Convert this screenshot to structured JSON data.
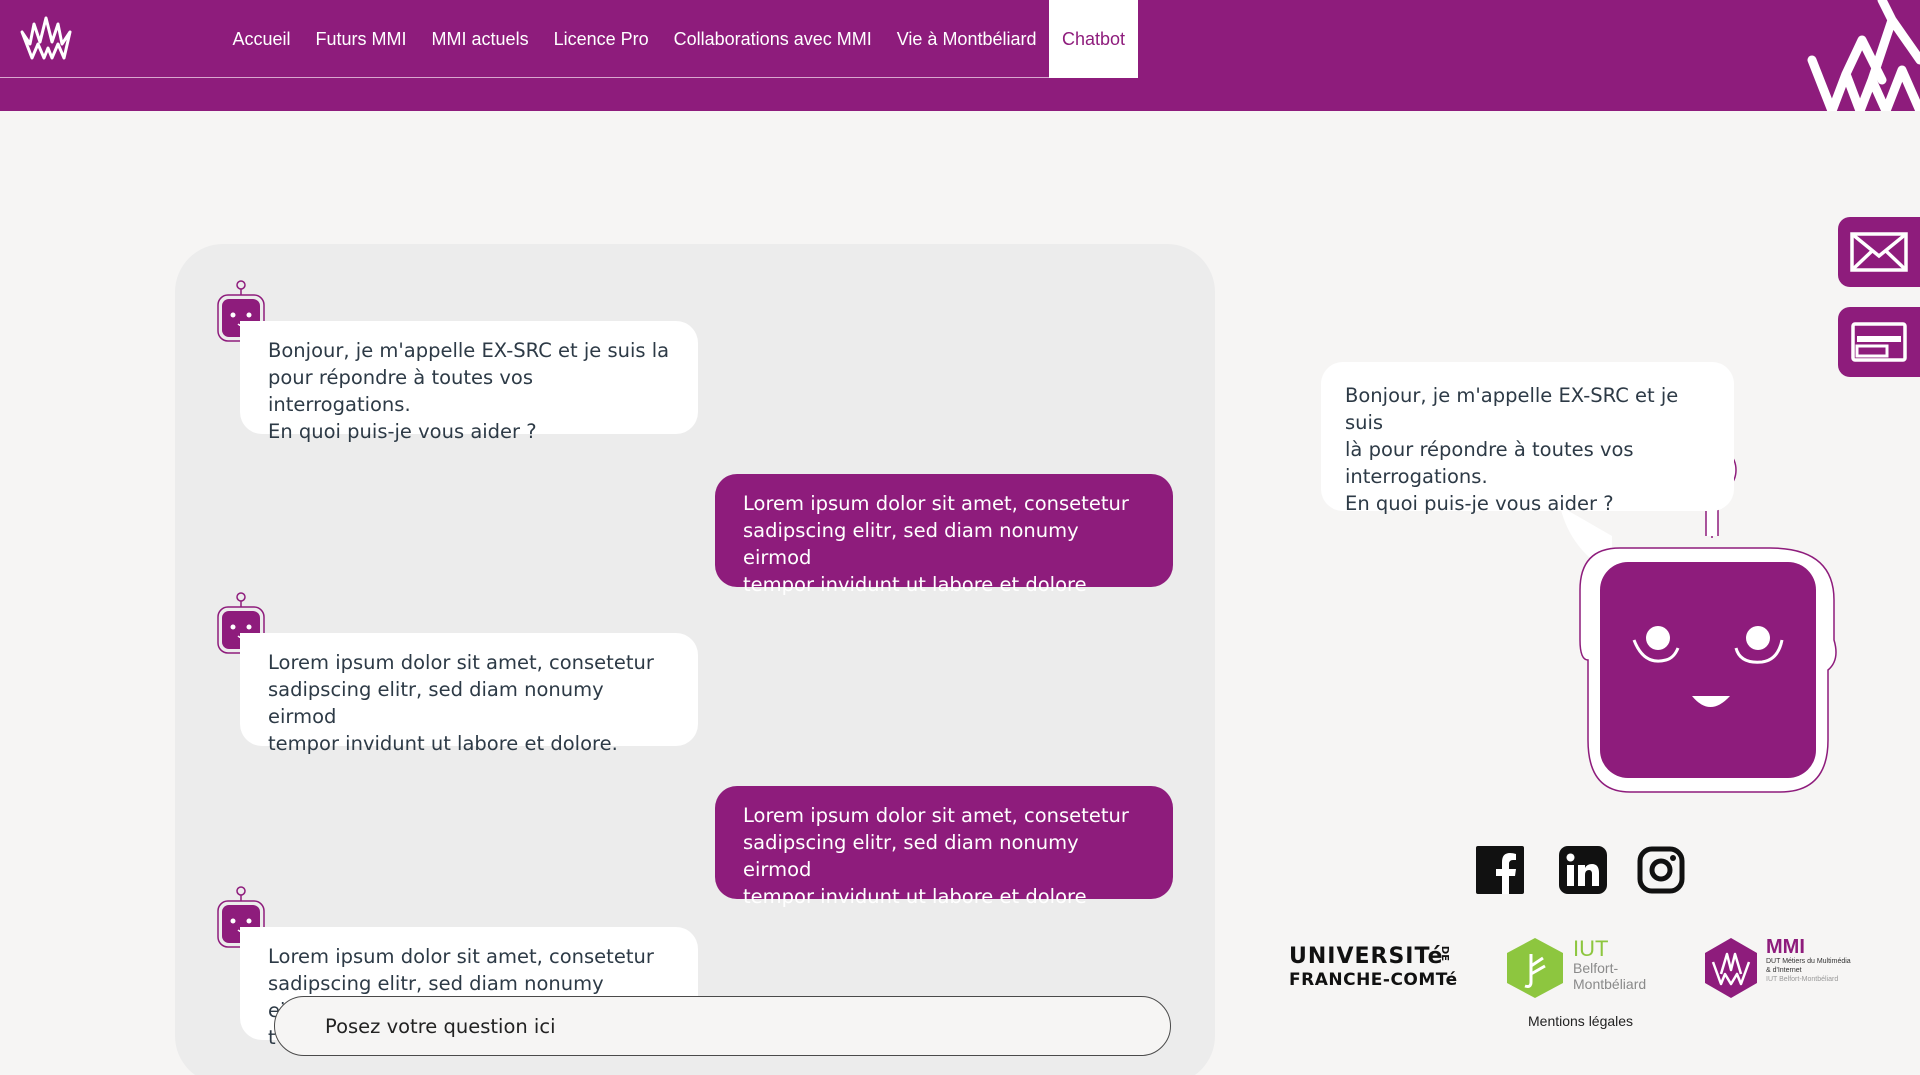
{
  "header": {
    "nav": [
      {
        "label": "Accueil"
      },
      {
        "label": "Futurs MMI"
      },
      {
        "label": "MMI actuels"
      },
      {
        "label": "Licence Pro"
      },
      {
        "label": "Collaborations avec MMI"
      },
      {
        "label": "Vie à Montbéliard"
      },
      {
        "label": "Chatbot",
        "active": true
      }
    ]
  },
  "side_tabs": {
    "mail_icon": "envelope-icon",
    "browser_icon": "window-icon"
  },
  "chat": {
    "messages": [
      {
        "from": "bot",
        "text": "Bonjour, je m'appelle EX-SRC et je suis la\npour répondre à toutes vos interrogations.\nEn quoi puis-je vous aider ?"
      },
      {
        "from": "user",
        "text": "Lorem ipsum dolor sit amet, consetetur\nsadipscing elitr, sed diam nonumy eirmod\ntempor invidunt ut labore et dolore"
      },
      {
        "from": "bot",
        "text": "Lorem ipsum dolor sit amet, consetetur\nsadipscing elitr, sed diam nonumy eirmod\ntempor invidunt ut labore et dolore."
      },
      {
        "from": "user",
        "text": "Lorem ipsum dolor sit amet, consetetur\nsadipscing elitr, sed diam nonumy eirmod\ntempor invidunt ut labore et dolore"
      },
      {
        "from": "bot",
        "text": "Lorem ipsum dolor sit amet, consetetur\nsadipscing elitr, sed diam nonumy eirmod\nt"
      }
    ],
    "input_placeholder": "Posez votre question ici"
  },
  "robot_panel": {
    "greeting": "Bonjour, je m'appelle EX-SRC et je suis\nlà pour répondre à toutes vos\ninterrogations.\nEn quoi puis-je vous aider ?"
  },
  "social": [
    "facebook-icon",
    "linkedin-icon",
    "instagram-icon"
  ],
  "partners": {
    "ufc_line1": "UNIVERSITé",
    "ufc_de": "DE",
    "ufc_line2": "FRANCHE-COMTé",
    "iut_title": "IUT",
    "iut_line1": "Belfort-",
    "iut_line2": "Montbéliard",
    "mmi_title": "MMI",
    "mmi_line1": "DUT Métiers du Multimédia",
    "mmi_line2": "& d'Internet",
    "mmi_line3": "IUT Belfort-Montbéliard"
  },
  "footer": {
    "legal": "Mentions légales"
  },
  "colors": {
    "brand": "#8e1c7c",
    "iut_green": "#8dc63f"
  }
}
